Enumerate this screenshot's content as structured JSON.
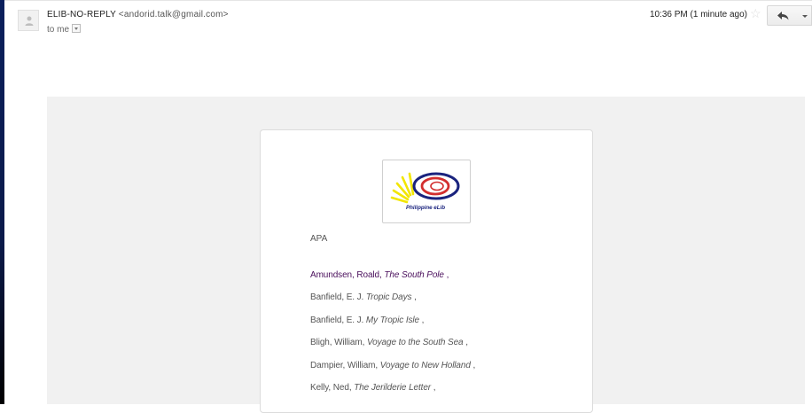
{
  "header": {
    "sender_name": "ELIB-NO-REPLY",
    "sender_email": "<andorid.talk@gmail.com>",
    "to_line": "to me",
    "timestamp": "10:36 PM (1 minute ago)"
  },
  "icons": {
    "avatar": "person-silhouette-icon",
    "star": "star-icon",
    "reply": "reply-arrow-icon",
    "more": "dropdown-caret-icon",
    "to_toggle": "expand-details-icon"
  },
  "email_body": {
    "logo_text": "Philippine eLib",
    "citation_style": "APA",
    "entries": [
      {
        "author": "Amundsen, Roald,",
        "title": "The South Pole",
        "end": ",",
        "visited": true
      },
      {
        "author": "Banfield, E. J.",
        "title": "Tropic Days",
        "end": ",",
        "visited": false
      },
      {
        "author": "Banfield, E. J.",
        "title": "My Tropic Isle",
        "end": ",",
        "visited": false
      },
      {
        "author": "Bligh, William,",
        "title": "Voyage to the South Sea",
        "end": ",",
        "visited": false
      },
      {
        "author": "Dampier, William,",
        "title": "Voyage to New Holland",
        "end": ",",
        "visited": false
      },
      {
        "author": "Kelly, Ned,",
        "title": "The Jerilderie Letter",
        "end": ",",
        "visited": false
      }
    ]
  },
  "colors": {
    "background_panel": "#f1f1f1",
    "visited_link": "#4a0f5c",
    "logo_navy": "#1a237e",
    "logo_red": "#d32f2f",
    "logo_yellow": "#f2e600"
  }
}
